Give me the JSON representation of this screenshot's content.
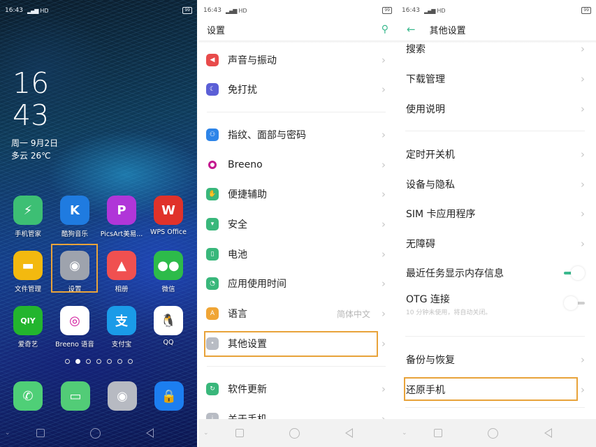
{
  "status_bar": {
    "time": "16:43",
    "signal": "⁴ᴳ",
    "network": "HD",
    "battery": "99"
  },
  "home": {
    "clock_hour": "16",
    "clock_minute": "43",
    "date": "周一  9月2日",
    "weather": "多云 26℃",
    "apps": [
      {
        "label": "手机管家",
        "icon": "phone-manager-icon",
        "glyph": "⚡",
        "bg": "#3dbf74"
      },
      {
        "label": "酷狗音乐",
        "icon": "kugou-music-icon",
        "glyph": "K",
        "bg": "#1f7be0"
      },
      {
        "label": "PicsArt美易...",
        "icon": "picsart-icon",
        "glyph": "P",
        "bg": "#b036d8"
      },
      {
        "label": "WPS Office",
        "icon": "wps-office-icon",
        "glyph": "W",
        "bg": "#e0322a"
      },
      {
        "label": "文件管理",
        "icon": "file-manager-icon",
        "glyph": "▬",
        "bg": "#f3b90f"
      },
      {
        "label": "设置",
        "icon": "settings-icon",
        "glyph": "◉",
        "bg": "#9ea3ad"
      },
      {
        "label": "相册",
        "icon": "gallery-icon",
        "glyph": "▲",
        "bg": "#f05050"
      },
      {
        "label": "微信",
        "icon": "wechat-icon",
        "glyph": "●●",
        "bg": "#2dbb4a"
      },
      {
        "label": "爱奇艺",
        "icon": "iqiyi-icon",
        "glyph": "QIY",
        "bg": "#23b52e"
      },
      {
        "label": "Breeno 语音",
        "icon": "breeno-voice-icon",
        "glyph": "◎",
        "bg": "#ffffff"
      },
      {
        "label": "支付宝",
        "icon": "alipay-icon",
        "glyph": "支",
        "bg": "#1a9be8"
      },
      {
        "label": "QQ",
        "icon": "qq-icon",
        "glyph": "🐧",
        "bg": "#ffffff"
      }
    ],
    "page_count": 7,
    "active_page": 1,
    "dock": [
      {
        "icon": "phone-dial-icon",
        "glyph": "✆",
        "bg": "#4fcf77"
      },
      {
        "icon": "messages-icon",
        "glyph": "▭",
        "bg": "#52cc77"
      },
      {
        "icon": "camera-icon",
        "glyph": "◉",
        "bg": "#b7bac2"
      },
      {
        "icon": "lock-icon",
        "glyph": "🔒",
        "bg": "#1c7ef0"
      }
    ],
    "highlight_color": "#e8a33a"
  },
  "settings": {
    "title": "设置",
    "items": [
      {
        "label": "声音与振动",
        "icon": "sound-icon",
        "bg": "#e84b4b",
        "glyph": "◀"
      },
      {
        "label": "免打扰",
        "icon": "do-not-disturb-icon",
        "bg": "#5b5fd6",
        "glyph": "☾"
      },
      {
        "label": "指纹、面部与密码",
        "icon": "fingerprint-icon",
        "bg": "#2d84e8",
        "glyph": "⚇"
      },
      {
        "label": "Breeno",
        "icon": "breeno-icon",
        "bg": "#c4188f",
        "glyph": ""
      },
      {
        "label": "便捷辅助",
        "icon": "assist-icon",
        "bg": "#39b77b",
        "glyph": "✋"
      },
      {
        "label": "安全",
        "icon": "security-icon",
        "bg": "#39b77b",
        "glyph": "▾"
      },
      {
        "label": "电池",
        "icon": "battery-icon",
        "bg": "#39b77b",
        "glyph": "▯"
      },
      {
        "label": "应用使用时间",
        "icon": "app-usage-icon",
        "bg": "#39b77b",
        "glyph": "◔"
      },
      {
        "label": "语言",
        "icon": "language-icon",
        "bg": "#f0a535",
        "glyph": "A",
        "value": "简体中文"
      },
      {
        "label": "其他设置",
        "icon": "other-settings-icon",
        "bg": "#b8bcc4",
        "glyph": "•"
      },
      {
        "label": "软件更新",
        "icon": "software-update-icon",
        "bg": "#39b77b",
        "glyph": "↻"
      },
      {
        "label": "关于手机",
        "icon": "about-phone-icon",
        "bg": "#b8bcc4",
        "glyph": "i"
      }
    ]
  },
  "other_settings": {
    "title": "其他设置",
    "items": [
      {
        "label": "搜索"
      },
      {
        "label": "下载管理"
      },
      {
        "label": "使用说明"
      },
      {
        "label": "定时开关机"
      },
      {
        "label": "设备与隐私"
      },
      {
        "label": "SIM 卡应用程序"
      },
      {
        "label": "无障碍"
      },
      {
        "label": "最近任务显示内存信息",
        "toggle": true
      },
      {
        "label": "OTG 连接",
        "toggle": false,
        "sub": "10 分钟未使用，将自动关闭。"
      },
      {
        "label": "备份与恢复"
      },
      {
        "label": "还原手机"
      }
    ]
  },
  "colors": {
    "accent": "#3bb98e",
    "highlight": "#e8a33a"
  },
  "chevron": "›"
}
